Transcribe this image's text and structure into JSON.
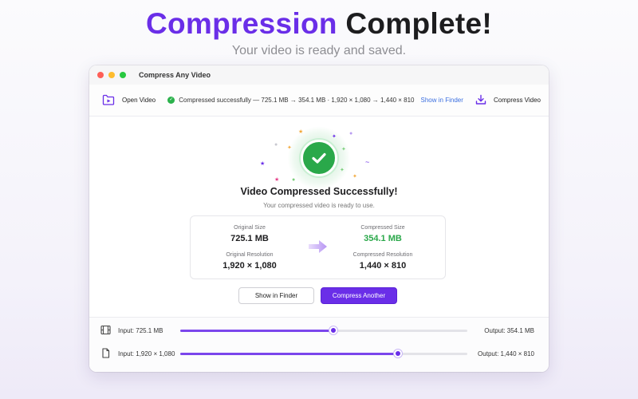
{
  "hero": {
    "title_accent": "Compression",
    "title_rest": "Complete!",
    "subtitle": "Your video is ready and saved."
  },
  "window": {
    "title": "Compress Any Video"
  },
  "toolbar": {
    "open_label": "Open Video",
    "status_text": "Compressed successfully — 725.1 MB → 354.1 MB · 1,920 × 1,080 → 1,440 × 810",
    "show_in_finder": "Show in Finder",
    "compress_label": "Compress Video"
  },
  "success": {
    "title": "Video Compressed Successfully!",
    "subtitle": "Your compressed video is ready to use."
  },
  "stats": {
    "original_size_label": "Original Size",
    "original_size": "725.1 MB",
    "original_res_label": "Original Resolution",
    "original_res": "1,920 × 1,080",
    "compressed_size_label": "Compressed Size",
    "compressed_size": "354.1 MB",
    "compressed_res_label": "Compressed Resolution",
    "compressed_res": "1,440 × 810"
  },
  "actions": {
    "show_in_finder": "Show in Finder",
    "compress_another": "Compress Another"
  },
  "sliders": [
    {
      "input": "Input: 725.1 MB",
      "output": "Output: 354.1 MB",
      "level": 0.533,
      "icon": "film-icon"
    },
    {
      "input": "Input: 1,920 × 1,080",
      "output": "Output: 1,440 × 810",
      "level": 0.758,
      "icon": "document-icon"
    }
  ],
  "colors": {
    "accent": "#6a2ee8",
    "success": "#2aa84a",
    "link": "#3b6fe0",
    "traffic_red": "#fe5f57",
    "traffic_yellow": "#febc2e",
    "traffic_green": "#28c840"
  }
}
